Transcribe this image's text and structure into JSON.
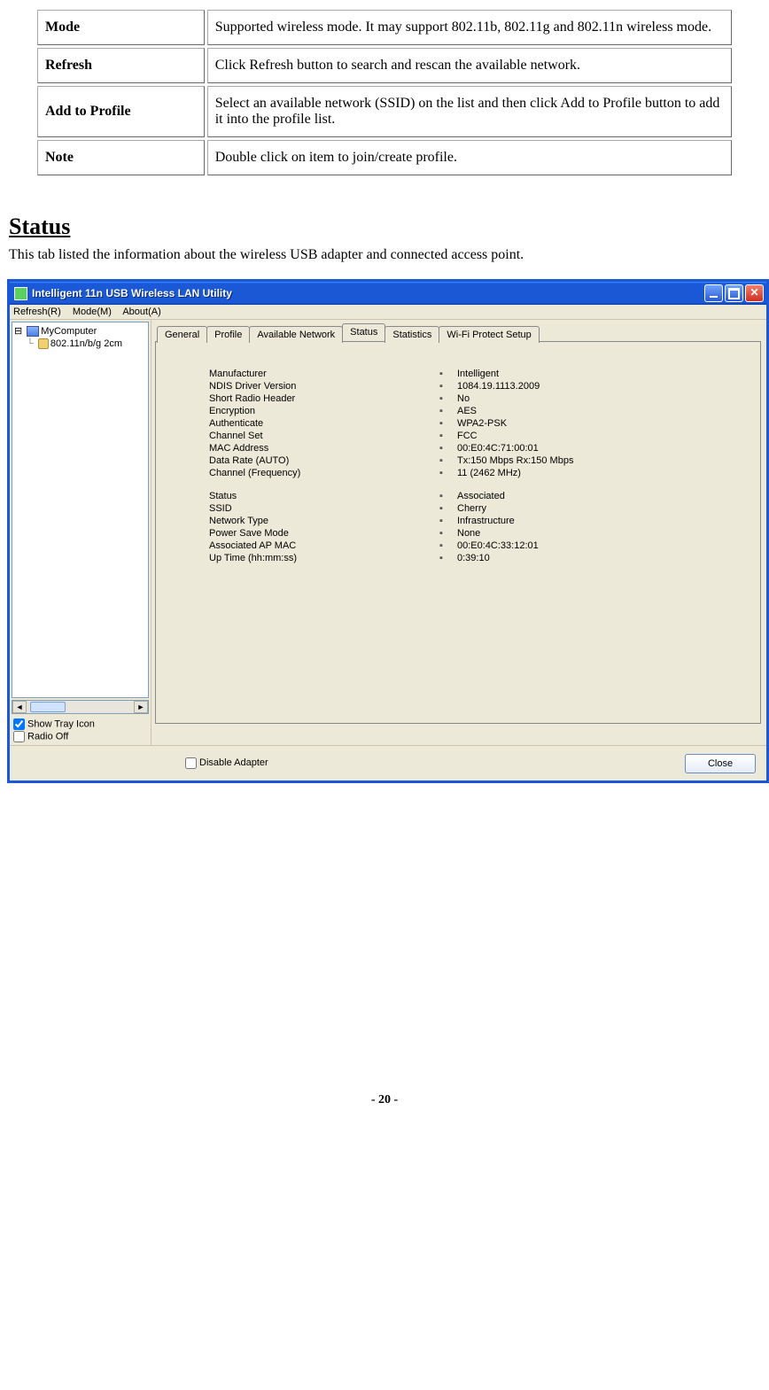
{
  "table_rows": [
    {
      "label": "Mode",
      "desc": "Supported wireless mode. It may support 802.11b, 802.11g and 802.11n wireless mode."
    },
    {
      "label": "Refresh",
      "desc": "Click Refresh button to search and rescan the available network."
    },
    {
      "label": "Add to Profile",
      "desc": "Select an available network (SSID) on the list and then click Add to Profile button to add it into the profile list."
    },
    {
      "label": "Note",
      "desc": "Double click on item to join/create profile."
    }
  ],
  "section": {
    "heading": "Status",
    "desc": "This tab listed the information about the wireless USB adapter and connected access point."
  },
  "window": {
    "title": "Intelligent 11n USB Wireless LAN Utility",
    "menus": [
      "Refresh(R)",
      "Mode(M)",
      "About(A)"
    ],
    "tree": {
      "root": "MyComputer",
      "child": "802.11n/b/g 2cm"
    },
    "tree_checks": [
      {
        "label": "Show Tray Icon",
        "checked": true
      },
      {
        "label": "Radio Off",
        "checked": false
      }
    ],
    "disable_adapter": {
      "label": "Disable Adapter",
      "checked": false
    },
    "close_btn": "Close",
    "tabs": [
      "General",
      "Profile",
      "Available Network",
      "Status",
      "Statistics",
      "Wi-Fi Protect Setup"
    ],
    "active_tab_index": 3,
    "status_rows_a": [
      {
        "k": "Manufacturer",
        "v": "Intelligent"
      },
      {
        "k": "NDIS Driver Version",
        "v": "1084.19.1113.2009"
      },
      {
        "k": "Short Radio Header",
        "v": "No"
      },
      {
        "k": "Encryption",
        "v": "AES"
      },
      {
        "k": "Authenticate",
        "v": "WPA2-PSK"
      },
      {
        "k": "Channel Set",
        "v": "FCC"
      },
      {
        "k": "MAC Address",
        "v": "00:E0:4C:71:00:01"
      },
      {
        "k": "Data Rate (AUTO)",
        "v": "Tx:150 Mbps Rx:150 Mbps"
      },
      {
        "k": "Channel (Frequency)",
        "v": "11 (2462 MHz)"
      }
    ],
    "status_rows_b": [
      {
        "k": "Status",
        "v": "Associated"
      },
      {
        "k": "SSID",
        "v": "Cherry"
      },
      {
        "k": "Network Type",
        "v": "Infrastructure"
      },
      {
        "k": "Power Save Mode",
        "v": "None"
      },
      {
        "k": "Associated AP MAC",
        "v": "00:E0:4C:33:12:01"
      },
      {
        "k": "Up Time (hh:mm:ss)",
        "v": "0:39:10"
      }
    ]
  },
  "page_num": "- 20 -"
}
